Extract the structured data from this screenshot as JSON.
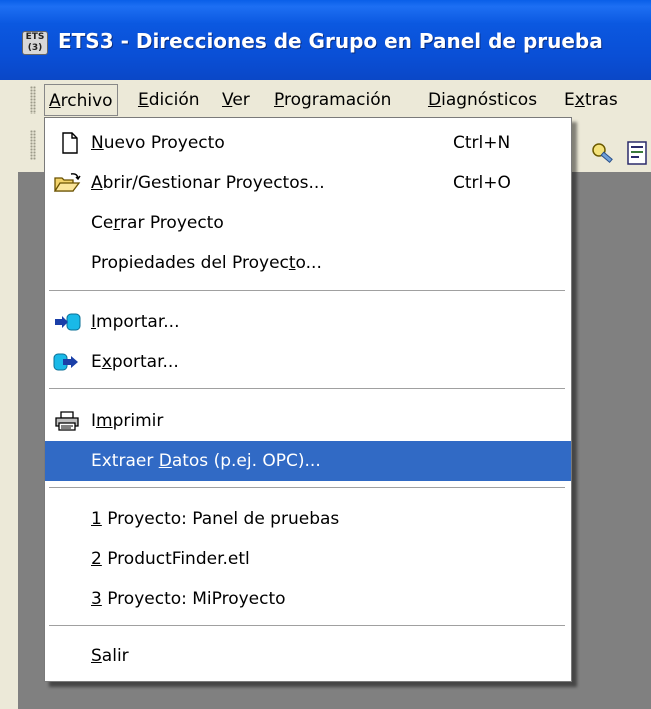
{
  "window": {
    "icon_text": "ETS\n(3)",
    "title": "ETS3 - Direcciones de Grupo en Panel de prueba"
  },
  "menubar": {
    "items": [
      {
        "label_u": "A",
        "label_rest": "rchivo"
      },
      {
        "label_u": "E",
        "label_rest": "dición"
      },
      {
        "label_u": "V",
        "label_rest": "er"
      },
      {
        "label_u": "P",
        "label_rest": "rogramación"
      },
      {
        "label_u": "D",
        "label_rest": "iagnósticos"
      },
      {
        "label_pre": "E",
        "label_u": "x",
        "label_rest": "tras"
      }
    ]
  },
  "archivo_menu": {
    "items": [
      {
        "pre": "",
        "u": "N",
        "post": "uevo Proyecto",
        "shortcut": "Ctrl+N",
        "icon": "new-document-icon"
      },
      {
        "pre": "",
        "u": "A",
        "post": "brir/Gestionar Proyectos...",
        "shortcut": "Ctrl+O",
        "icon": "open-folder-icon"
      },
      {
        "pre": "Ce",
        "u": "r",
        "post": "rar Proyecto",
        "shortcut": "",
        "icon": ""
      },
      {
        "pre": "Propiedades del Proyec",
        "u": "t",
        "post": "o...",
        "shortcut": "",
        "icon": ""
      },
      {
        "pre": "",
        "u": "I",
        "post": "mportar...",
        "shortcut": "",
        "icon": "import-icon"
      },
      {
        "pre": "E",
        "u": "x",
        "post": "portar...",
        "shortcut": "",
        "icon": "export-icon"
      },
      {
        "pre": "I",
        "u": "m",
        "post": "primir",
        "shortcut": "",
        "icon": "printer-icon"
      },
      {
        "pre": "Extraer ",
        "u": "D",
        "post": "atos (p.ej. OPC)...",
        "shortcut": "",
        "icon": ""
      },
      {
        "pre": "",
        "u": "1",
        "post": " Proyecto: Panel de pruebas",
        "shortcut": "",
        "icon": ""
      },
      {
        "pre": "",
        "u": "2",
        "post": " ProductFinder.etl",
        "shortcut": "",
        "icon": ""
      },
      {
        "pre": "",
        "u": "3",
        "post": " Proyecto: MiProyecto",
        "shortcut": "",
        "icon": ""
      },
      {
        "pre": "",
        "u": "S",
        "post": "alir",
        "shortcut": "",
        "icon": ""
      }
    ],
    "highlighted_item": "Extraer Datos (p.ej. OPC)..."
  },
  "colors": {
    "title_bar": "#0a4fd6",
    "menu_bg": "#ece9d8",
    "highlight": "#316ac5",
    "workspace": "#808080"
  }
}
